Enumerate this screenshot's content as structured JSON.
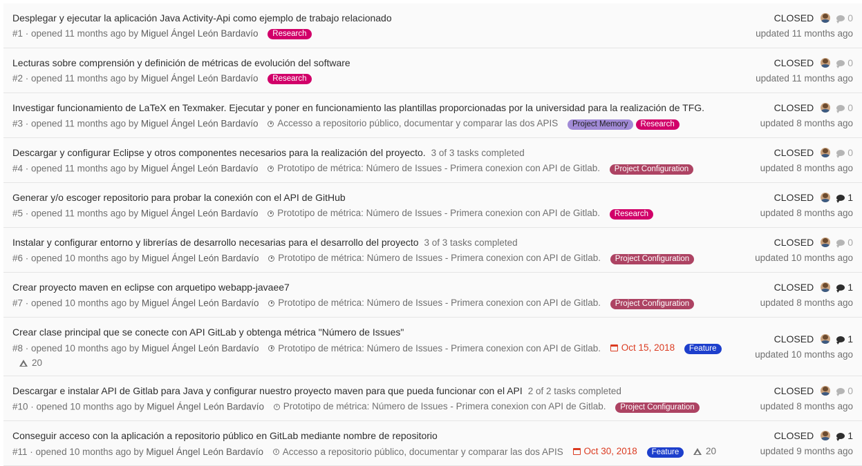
{
  "colors": {
    "research": "#d10069",
    "project_memory": "#a18ad6",
    "project_configuration": "#ad4363",
    "feature": "#1d3fcc",
    "due_date": "#db3b21"
  },
  "issues": [
    {
      "title": "Desplegar y ejecutar la aplicación Java Activity-Api como ejemplo de trabajo relacionado",
      "tasks": "",
      "ref": "#1",
      "opened": " · opened 11 months ago by ",
      "author": "Miguel Ángel León Bardavío",
      "milestone": "",
      "due": "",
      "labels": [
        {
          "text": "Research",
          "color": "#d10069"
        }
      ],
      "weight": "",
      "status": "CLOSED",
      "comments": "0",
      "updated": "updated 11 months ago"
    },
    {
      "title": "Lecturas sobre comprensión y definición de métricas de evolución del software",
      "tasks": "",
      "ref": "#2",
      "opened": " · opened 11 months ago by ",
      "author": "Miguel Ángel León Bardavío",
      "milestone": "",
      "due": "",
      "labels": [
        {
          "text": "Research",
          "color": "#d10069"
        }
      ],
      "weight": "",
      "status": "CLOSED",
      "comments": "0",
      "updated": "updated 11 months ago"
    },
    {
      "title": "Investigar funcionamiento de LaTeX en Texmaker. Ejecutar y poner en funcionamiento las plantillas proporcionadas por la universidad para la realización de TFG.",
      "tasks": "",
      "ref": "#3",
      "opened": " · opened 11 months ago by ",
      "author": "Miguel Ángel León Bardavío",
      "milestone": "Accesso a repositorio público, documentar y comparar las dos APIS",
      "due": "",
      "labels": [
        {
          "text": "Project Memory",
          "color": "#a18ad6",
          "dark": true
        },
        {
          "text": "Research",
          "color": "#d10069"
        }
      ],
      "weight": "",
      "status": "CLOSED",
      "comments": "0",
      "updated": "updated 8 months ago"
    },
    {
      "title": "Descargar y configurar Eclipse y otros componentes necesarios para la realización del proyecto.",
      "tasks": "3 of 3 tasks completed",
      "ref": "#4",
      "opened": " · opened 11 months ago by ",
      "author": "Miguel Ángel León Bardavío",
      "milestone": "Prototipo de métrica: Número de Issues - Primera conexion con API de Gitlab.",
      "due": "",
      "labels": [
        {
          "text": "Project Configuration",
          "color": "#ad4363"
        }
      ],
      "weight": "",
      "status": "CLOSED",
      "comments": "0",
      "updated": "updated 8 months ago"
    },
    {
      "title": "Generar y/o escoger repositorio para probar la conexión con el API de GitHub",
      "tasks": "",
      "ref": "#5",
      "opened": " · opened 11 months ago by ",
      "author": "Miguel Ángel León Bardavío",
      "milestone": "Prototipo de métrica: Número de Issues - Primera conexion con API de Gitlab.",
      "due": "",
      "labels": [
        {
          "text": "Research",
          "color": "#d10069"
        }
      ],
      "weight": "",
      "status": "CLOSED",
      "comments": "1",
      "updated": "updated 8 months ago"
    },
    {
      "title": "Instalar y configurar entorno y librerías de desarrollo necesarias para el desarrollo del proyecto",
      "tasks": "3 of 3 tasks completed",
      "ref": "#6",
      "opened": " · opened 10 months ago by ",
      "author": "Miguel Ángel León Bardavío",
      "milestone": "Prototipo de métrica: Número de Issues - Primera conexion con API de Gitlab.",
      "due": "",
      "labels": [
        {
          "text": "Project Configuration",
          "color": "#ad4363"
        }
      ],
      "weight": "",
      "status": "CLOSED",
      "comments": "0",
      "updated": "updated 10 months ago"
    },
    {
      "title": "Crear proyecto maven en eclipse con arquetipo webapp-javaee7",
      "tasks": "",
      "ref": "#7",
      "opened": " · opened 10 months ago by ",
      "author": "Miguel Ángel León Bardavío",
      "milestone": "Prototipo de métrica: Número de Issues - Primera conexion con API de Gitlab.",
      "due": "",
      "labels": [
        {
          "text": "Project Configuration",
          "color": "#ad4363"
        }
      ],
      "weight": "",
      "status": "CLOSED",
      "comments": "1",
      "updated": "updated 8 months ago"
    },
    {
      "title": "Crear clase principal que se conecte con API GitLab y obtenga métrica \"Número de Issues\"",
      "tasks": "",
      "ref": "#8",
      "opened": " · opened 10 months ago by ",
      "author": "Miguel Ángel León Bardavío",
      "milestone": "Prototipo de métrica: Número de Issues - Primera conexion con API de Gitlab.",
      "due": "Oct 15, 2018",
      "labels": [
        {
          "text": "Feature",
          "color": "#1d3fcc"
        }
      ],
      "weight": "20",
      "weight_wrapped": true,
      "status": "CLOSED",
      "comments": "1",
      "updated": "updated 10 months ago"
    },
    {
      "title": "Descargar e instalar API de Gitlab para Java y configurar nuestro proyecto maven para que pueda funcionar con el API",
      "tasks": "2 of 2 tasks completed",
      "ref": "#10",
      "opened": " · opened 10 months ago by ",
      "author": "Miguel Ángel León Bardavío",
      "milestone": "Prototipo de métrica: Número de Issues - Primera conexion con API de Gitlab.",
      "due": "",
      "labels": [
        {
          "text": "Project Configuration",
          "color": "#ad4363"
        }
      ],
      "weight": "",
      "status": "CLOSED",
      "comments": "0",
      "updated": "updated 8 months ago"
    },
    {
      "title": "Conseguir acceso con la aplicación a repositorio público en GitLab mediante nombre de repositorio",
      "tasks": "",
      "ref": "#11",
      "opened": " · opened 10 months ago by ",
      "author": "Miguel Ángel León Bardavío",
      "milestone": "Accesso a repositorio público, documentar y comparar las dos APIS",
      "due": "Oct 30, 2018",
      "labels": [
        {
          "text": "Feature",
          "color": "#1d3fcc"
        }
      ],
      "weight": "20",
      "weight_wrapped": false,
      "status": "CLOSED",
      "comments": "1",
      "updated": "updated 9 months ago"
    }
  ]
}
